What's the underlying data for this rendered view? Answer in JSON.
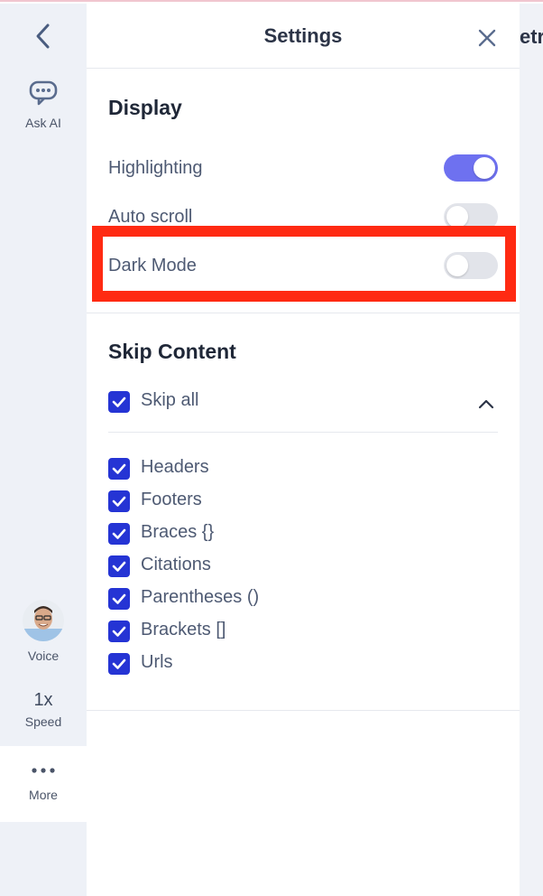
{
  "header": {
    "title": "Settings"
  },
  "rail": {
    "ask_ai_label": "Ask AI",
    "voice_label": "Voice",
    "speed_value": "1x",
    "speed_label": "Speed",
    "more_label": "More"
  },
  "display": {
    "title": "Display",
    "toggles": [
      {
        "label": "Highlighting",
        "on": true
      },
      {
        "label": "Auto scroll",
        "on": false
      },
      {
        "label": "Dark Mode",
        "on": false
      }
    ]
  },
  "skip": {
    "title": "Skip Content",
    "skip_all_label": "Skip all",
    "items": [
      {
        "label": "Headers",
        "checked": true
      },
      {
        "label": "Footers",
        "checked": true
      },
      {
        "label": "Braces {}",
        "checked": true
      },
      {
        "label": "Citations",
        "checked": true
      },
      {
        "label": "Parentheses ()",
        "checked": true
      },
      {
        "label": "Brackets []",
        "checked": true
      },
      {
        "label": "Urls",
        "checked": true
      }
    ]
  },
  "background_text": "etr",
  "colors": {
    "accent": "#6e71f0",
    "checkbox": "#2534d4",
    "highlight_box": "#ff2a12",
    "rail_bg": "#eef1f7"
  }
}
